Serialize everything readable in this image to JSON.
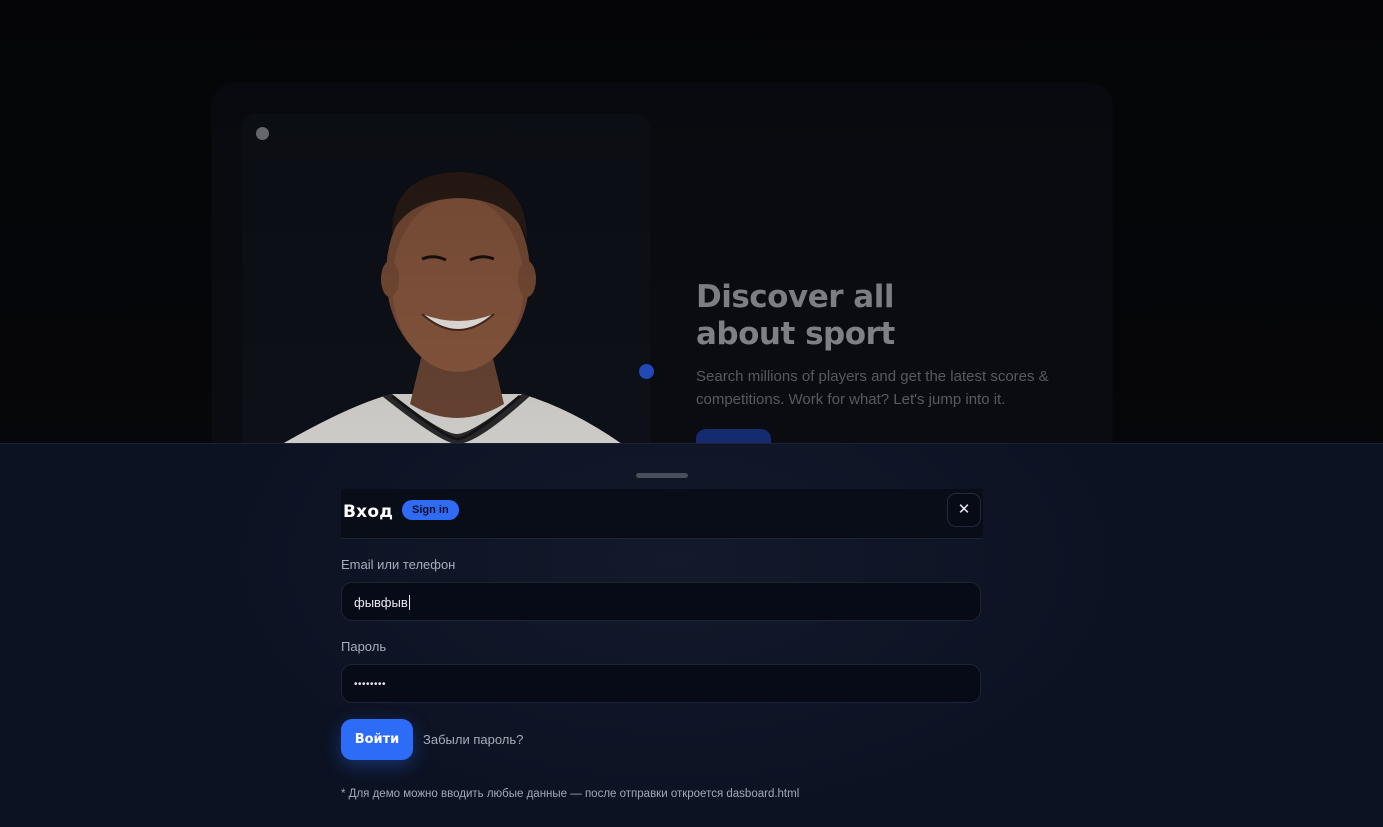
{
  "hero": {
    "title": "Discover all\nabout sport",
    "subtitle": "Search millions of players and get the latest scores & competitions. Work for what? Let's jump into it."
  },
  "modal": {
    "title": "Вход",
    "badge": "Sign in",
    "close_icon": "close-icon",
    "email_label": "Email или телефон",
    "email_value": "фывфыв",
    "password_label": "Пароль",
    "password_value": "••••••••",
    "submit_label": "Войти",
    "forgot_label": "Забыли пароль?",
    "note": "* Для демо можно вводить любые данные — после отправки откроется dasboard.html"
  },
  "colors": {
    "accent": "#2d6cf6",
    "sheet_bg": "#0c1222",
    "page_bg": "#06070a"
  }
}
